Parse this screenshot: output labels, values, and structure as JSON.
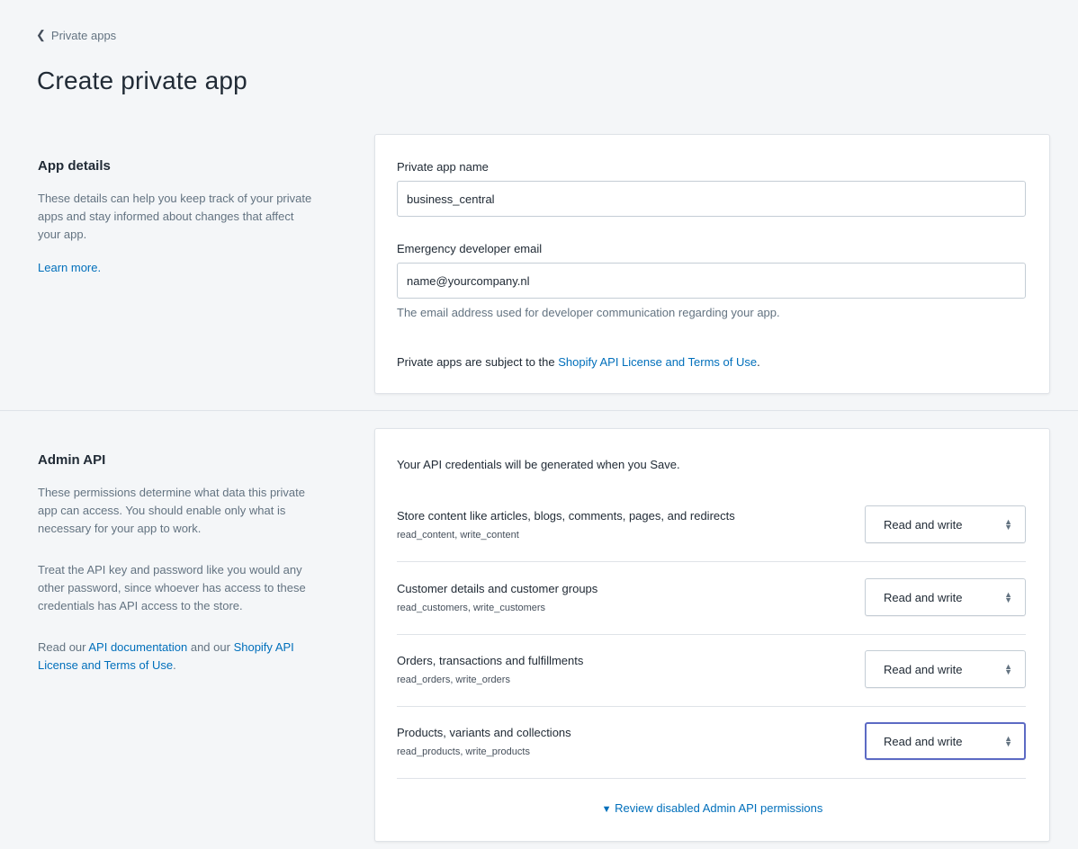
{
  "breadcrumb": {
    "label": "Private apps",
    "icon": "chevron-left-icon"
  },
  "page": {
    "title": "Create private app"
  },
  "app_details": {
    "heading": "App details",
    "description": "These details can help you keep track of your private apps and stay informed about changes that affect your app.",
    "learn_more": "Learn more.",
    "name_label": "Private app name",
    "name_value": "business_central",
    "email_label": "Emergency developer email",
    "email_value": "name@yourcompany.nl",
    "email_help": "The email address used for developer communication regarding your app.",
    "terms_prefix": "Private apps are subject to the ",
    "terms_link": "Shopify API License and Terms of Use",
    "terms_suffix": "."
  },
  "admin_api": {
    "heading": "Admin API",
    "desc1": "These permissions determine what data this private app can access. You should enable only what is necessary for your app to work.",
    "desc2": "Treat the API key and password like you would any other password, since whoever has access to these credentials has API access to the store.",
    "read_prefix": "Read our ",
    "api_doc_link": "API documentation",
    "read_middle": " and our ",
    "terms_link": "Shopify API License and Terms of Use",
    "read_suffix": ".",
    "credentials_note": "Your API credentials will be generated when you Save.",
    "permissions": [
      {
        "title": "Store content like articles, blogs, comments, pages, and redirects",
        "scopes": "read_content, write_content",
        "value": "Read and write"
      },
      {
        "title": "Customer details and customer groups",
        "scopes": "read_customers, write_customers",
        "value": "Read and write"
      },
      {
        "title": "Orders, transactions and fulfillments",
        "scopes": "read_orders, write_orders",
        "value": "Read and write"
      },
      {
        "title": "Products, variants and collections",
        "scopes": "read_products, write_products",
        "value": "Read and write"
      }
    ],
    "review_disabled": "Review disabled Admin API permissions",
    "review_icon": "triangle-down-icon"
  },
  "colors": {
    "link": "#006fbb",
    "focus": "#5c6ac4",
    "background": "#f4f6f8"
  }
}
